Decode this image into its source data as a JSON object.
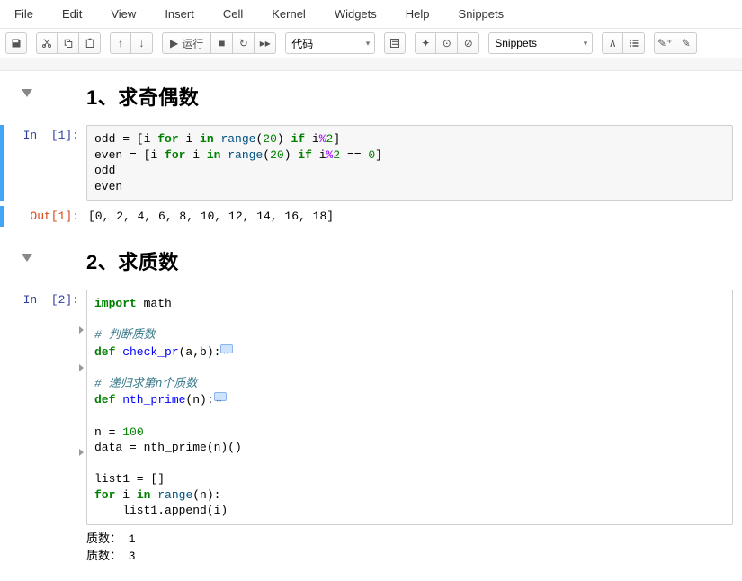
{
  "menu": {
    "items": [
      "File",
      "Edit",
      "View",
      "Insert",
      "Cell",
      "Kernel",
      "Widgets",
      "Help",
      "Snippets"
    ]
  },
  "toolbar": {
    "run_label": "运行",
    "celltype": "代码",
    "snippets": "Snippets"
  },
  "cells": [
    {
      "heading": "1、求奇偶数"
    },
    {
      "in_prompt": "In  [1]:",
      "out_prompt": "Out[1]:",
      "out_text": "[0, 2, 4, 6, 8, 10, 12, 14, 16, 18]"
    },
    {
      "heading": "2、求质数"
    },
    {
      "in_prompt": "In  [2]:",
      "stream1": "质数： 1",
      "stream2": "质数： 3"
    }
  ],
  "code1_raw": {
    "l1p1": "odd = [i ",
    "l1kw1": "for",
    "l1p2": " i ",
    "l1kw2": "in",
    "l1p3": " ",
    "l1fn": "range",
    "l1p4": "(",
    "l1n": "20",
    "l1p5": ") ",
    "l1kw3": "if",
    "l1p6": " i",
    "l1op": "%",
    "l1n2": "2",
    "l1p7": "]",
    "l2p1": "even = [i ",
    "l2kw1": "for",
    "l2p2": " i ",
    "l2kw2": "in",
    "l2p3": " ",
    "l2fn": "range",
    "l2p4": "(",
    "l2n": "20",
    "l2p5": ") ",
    "l2kw3": "if",
    "l2p6": " i",
    "l2op": "%",
    "l2n2": "2",
    "l2p7": " == ",
    "l2n3": "0",
    "l2p8": "]",
    "l3": "odd",
    "l4": "even"
  },
  "code2_raw": {
    "l1kw": "import",
    "l1p": " math",
    "c1": "# 判断质数",
    "l3kw": "def",
    "l3fn": " check_pr",
    "l3p": "(a,b):",
    "c2": "# 递归求第n个质数",
    "l5kw": "def",
    "l5fn": " nth_prime",
    "l5p": "(n):",
    "l7": "n = ",
    "l7n": "100",
    "l8": "data = nth_prime(n)()",
    "l10": "list1 = []",
    "l11kw1": "for",
    "l11p1": " i ",
    "l11kw2": "in",
    "l11p2": " ",
    "l11fn": "range",
    "l11p3": "(n):",
    "l12": "    list1.append(i)"
  },
  "chart_data": null
}
